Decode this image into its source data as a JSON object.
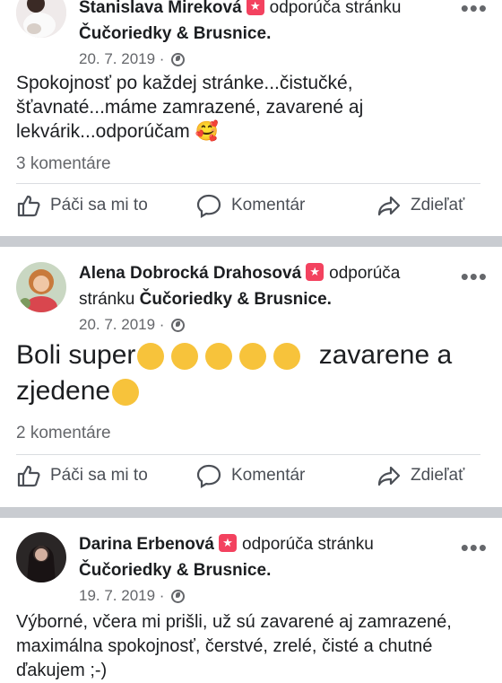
{
  "posts": [
    {
      "author": "Stanislava Mireková",
      "verb": "odporúča stránku",
      "page": "Čučoriedky & Brusnice.",
      "date": "20. 7. 2019 ·",
      "text": "Spokojnosť po každej stránke...čistučké, šťavnaté...máme zamrazené, zavarené aj lekvárik...odporúčam 🥰",
      "comments": "3 komentáre"
    },
    {
      "author": "Alena Dobrocká Drahosová",
      "verb": "odporúča stránku",
      "page": "Čučoriedky & Brusnice.",
      "date": "20. 7. 2019 ·",
      "text_line1_a": "Boli super",
      "text_line1_b": "zavarene a",
      "text_line2": "zjedene",
      "comments": "2 komentáre"
    },
    {
      "author": "Darina Erbenová",
      "verb": "odporúča stránku",
      "page": "Čučoriedky & Brusnice.",
      "date": "19. 7. 2019 ·",
      "text": "Výborné, včera mi prišli, už sú zavarené aj zamrazené, maximálna spokojnosť, čerstvé, zrelé, čisté a chutné ďakujem ;-)"
    }
  ],
  "actions": {
    "like": "Páči sa mi to",
    "comment": "Komentár",
    "share": "Zdieľať"
  },
  "icons": [
    "thumbs-up-icon",
    "comment-bubble-icon",
    "share-arrow-icon",
    "globe-icon",
    "more-icon",
    "recommend-star-icon"
  ],
  "colors": {
    "badge": "#f3425f",
    "secondary_text": "#65676b",
    "separator": "#c9ccd1"
  }
}
